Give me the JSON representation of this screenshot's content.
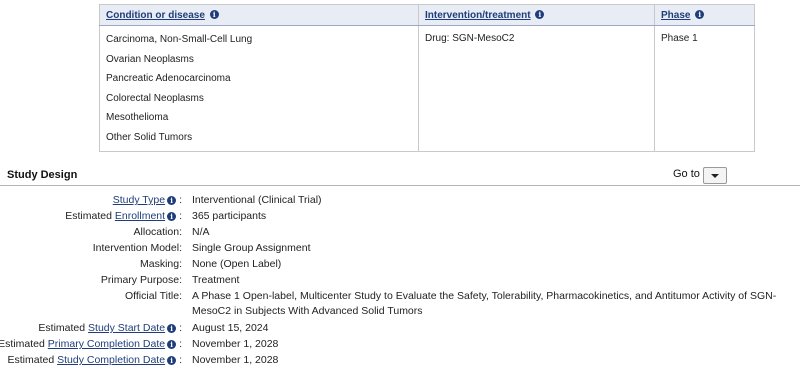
{
  "conditions_table": {
    "headers": {
      "condition": "Condition or disease",
      "intervention": "Intervention/treatment",
      "phase": "Phase"
    },
    "conditions": [
      "Carcinoma, Non-Small-Cell Lung",
      "Ovarian Neoplasms",
      "Pancreatic Adenocarcinoma",
      "Colorectal Neoplasms",
      "Mesothelioma",
      "Other Solid Tumors"
    ],
    "intervention": "Drug: SGN-MesoC2",
    "phase": "Phase 1"
  },
  "study_design": {
    "title": "Study Design",
    "goto_label": "Go to",
    "colon": ":",
    "rows": [
      {
        "prefix": "",
        "link": "Study Type",
        "plain": "",
        "value": "Interventional  (Clinical Trial)"
      },
      {
        "prefix": "Estimated ",
        "link": "Enrollment",
        "plain": "",
        "value": "365 participants"
      },
      {
        "prefix": "",
        "link": "",
        "plain": "Allocation:",
        "value": "N/A"
      },
      {
        "prefix": "",
        "link": "",
        "plain": "Intervention Model:",
        "value": "Single Group Assignment"
      },
      {
        "prefix": "",
        "link": "",
        "plain": "Masking:",
        "value": "None (Open Label)"
      },
      {
        "prefix": "",
        "link": "",
        "plain": "Primary Purpose:",
        "value": "Treatment"
      },
      {
        "prefix": "",
        "link": "",
        "plain": "Official Title:",
        "value": "A Phase 1 Open-label, Multicenter Study to Evaluate the Safety, Tolerability, Pharmacokinetics, and Antitumor Activity of SGN-MesoC2 in Subjects With Advanced Solid Tumors"
      },
      {
        "prefix": "Estimated ",
        "link": "Study Start Date",
        "plain": "",
        "value": "August 15, 2024"
      },
      {
        "prefix": "Estimated ",
        "link": "Primary Completion Date",
        "plain": "",
        "value": "November 1, 2028"
      },
      {
        "prefix": "Estimated ",
        "link": "Study Completion Date",
        "plain": "",
        "value": "November 1, 2028"
      }
    ]
  },
  "icons": {
    "info": "info-icon",
    "dropdown": "chevron-down-icon"
  },
  "colors": {
    "link": "#1f3d7a",
    "header_bg": "#e8ecf5"
  }
}
